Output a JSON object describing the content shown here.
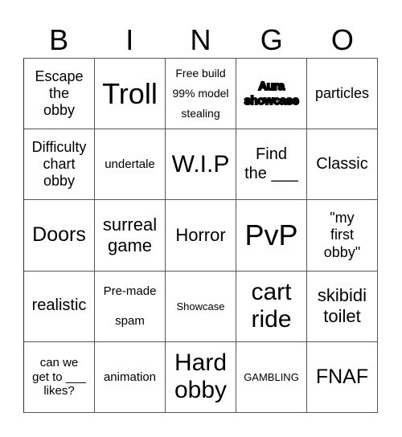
{
  "header": {
    "letters": [
      "B",
      "I",
      "N",
      "G",
      "O"
    ]
  },
  "cells": [
    {
      "text": "Escape\nthe\nobby"
    },
    {
      "text": "Troll"
    },
    {
      "text": "Free build\n99% model\nstealing"
    },
    {
      "text": "Aura\nshowcase"
    },
    {
      "text": "particles"
    },
    {
      "text": "Difficulty\nchart\nobby"
    },
    {
      "text": "undertale"
    },
    {
      "text": "W.I.P"
    },
    {
      "text": "Find\nthe ___"
    },
    {
      "text": "Classic"
    },
    {
      "text": "Doors"
    },
    {
      "text": "surreal\ngame"
    },
    {
      "text": "Horror"
    },
    {
      "text": "PvP"
    },
    {
      "text": "\"my\nfirst\nobby\""
    },
    {
      "text": "realistic"
    },
    {
      "text": "Pre-made\nspam"
    },
    {
      "text": "Showcase"
    },
    {
      "text": "cart\nride"
    },
    {
      "text": "skibidi\ntoilet"
    },
    {
      "text": "can we\nget to ___\nlikes?"
    },
    {
      "text": "animation"
    },
    {
      "text": "Hard\nobby"
    },
    {
      "text": "GAMBLING"
    },
    {
      "text": "FNAF"
    }
  ]
}
